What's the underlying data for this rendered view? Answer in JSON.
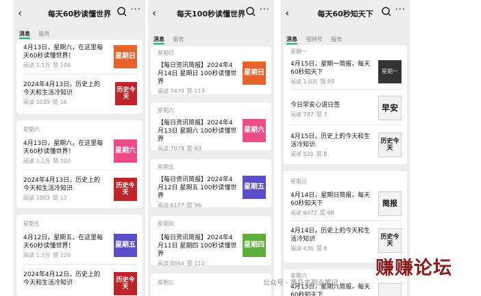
{
  "panels": [
    {
      "title": "每天60秒读懂世界",
      "tabs": [
        "消息",
        "服务"
      ],
      "groups": [
        {
          "day": "",
          "articles": [
            {
              "title": "4月13日，星期六，在这里每天60秒读懂世界！",
              "reads": "阅读 1.1万",
              "likes": "赞 109",
              "thumb": "星期日",
              "color": "#e8622c"
            },
            {
              "title": "2024年4月13日，历史上的今天和生活冷知识",
              "reads": "阅读 1025",
              "likes": "赞 16",
              "thumb": "历史今天",
              "color": "#c0242b"
            }
          ]
        },
        {
          "day": "星期六",
          "articles": [
            {
              "title": "4月13日，星期六，在这里每天60秒读懂世界！",
              "reads": "阅读 1.1万",
              "likes": "赞 100",
              "thumb": "星期六",
              "color": "#ec4d86"
            },
            {
              "title": "2024年4月13日，历史上的今天和生活冷知识",
              "reads": "阅读 1003",
              "likes": "赞 13",
              "thumb": "历史今天",
              "color": "#c0242b"
            }
          ]
        },
        {
          "day": "星期五",
          "articles": [
            {
              "title": "4月12日，星期五，在这里每天60秒读懂世界！",
              "reads": "阅读 1.3万",
              "likes": "赞 120",
              "thumb": "星期五",
              "color": "#5b4ec9"
            },
            {
              "title": "2024年4月12日，历史上的今天和生活冷知识",
              "reads": "",
              "likes": "",
              "thumb": "历史今天",
              "color": "#c0242b"
            }
          ]
        }
      ]
    },
    {
      "title": "每天100秒读懂世界",
      "tabs": [
        "消息",
        "服务"
      ],
      "groups": [
        {
          "day": "星期日",
          "articles": [
            {
              "title": "【每日资讯简报】2024年4月14日 星期日 100秒读懂世界",
              "reads": "阅读 7479",
              "likes": "赞 113",
              "thumb": "星期日",
              "color": "#e8622c"
            }
          ]
        },
        {
          "day": "星期六",
          "articles": [
            {
              "title": "【每日资讯简报】2024年4月13日 星期六 100秒读懂世界",
              "reads": "阅读 7079",
              "likes": "赞 93",
              "thumb": "星期六",
              "color": "#ec4d86"
            }
          ]
        },
        {
          "day": "星期五",
          "articles": [
            {
              "title": "【每日资讯简报】2024年4月12日 星期五 100秒读懂世界",
              "reads": "阅读 6177",
              "likes": "赞 96",
              "thumb": "星期五",
              "color": "#5b4ec9"
            }
          ]
        },
        {
          "day": "星期四",
          "articles": [
            {
              "title": "【每日资讯简报】2024年4月11日 星期四 100秒读懂世界",
              "reads": "阅读 8664",
              "likes": "赞 112",
              "thumb": "星期四",
              "color": "#5fae3c"
            }
          ]
        },
        {
          "day": "星期三",
          "articles": []
        }
      ]
    },
    {
      "title": "每天60秒知天下",
      "tabs": [
        "消息",
        "视频号",
        "服务"
      ],
      "groups": [
        {
          "day": "星期一",
          "articles": [
            {
              "title": "4月15日，星期一简报，每天60秒知天下",
              "reads": "阅读 1.0万",
              "likes": "赞 89",
              "thumb": "星期一",
              "color": "#333333"
            },
            {
              "title": "今日早安心语日签",
              "reads": "阅读 787",
              "likes": "赞 7",
              "thumb": "早安",
              "color": "#f2f2f2"
            },
            {
              "title": "4月15日，历史上的今天和生活冷知识",
              "reads": "阅读 521",
              "likes": "赞 8",
              "thumb": "历史今天",
              "color": "#f2f2f2"
            }
          ]
        },
        {
          "day": "星期日",
          "articles": [
            {
              "title": "4月14日，星期日简报，每天60秒知天下",
              "reads": "阅读 6472",
              "likes": "赞 68",
              "thumb": "简报",
              "color": "#f2f2f2"
            },
            {
              "title": "4月14日，历史上的今天和生活冷知识",
              "reads": "阅读 436",
              "likes": "赞 8",
              "thumb": "历史今天",
              "color": "#f2f2f2"
            }
          ]
        },
        {
          "day": "星期六",
          "articles": [
            {
              "title": "4月13日，星期六简报，每天60秒知天下",
              "reads": "",
              "likes": "",
              "thumb": "",
              "color": "#f2f2f2"
            }
          ]
        }
      ]
    }
  ],
  "watermark": "赚赚论坛",
  "caption": "公众号 · 黄岛主副业笔记"
}
